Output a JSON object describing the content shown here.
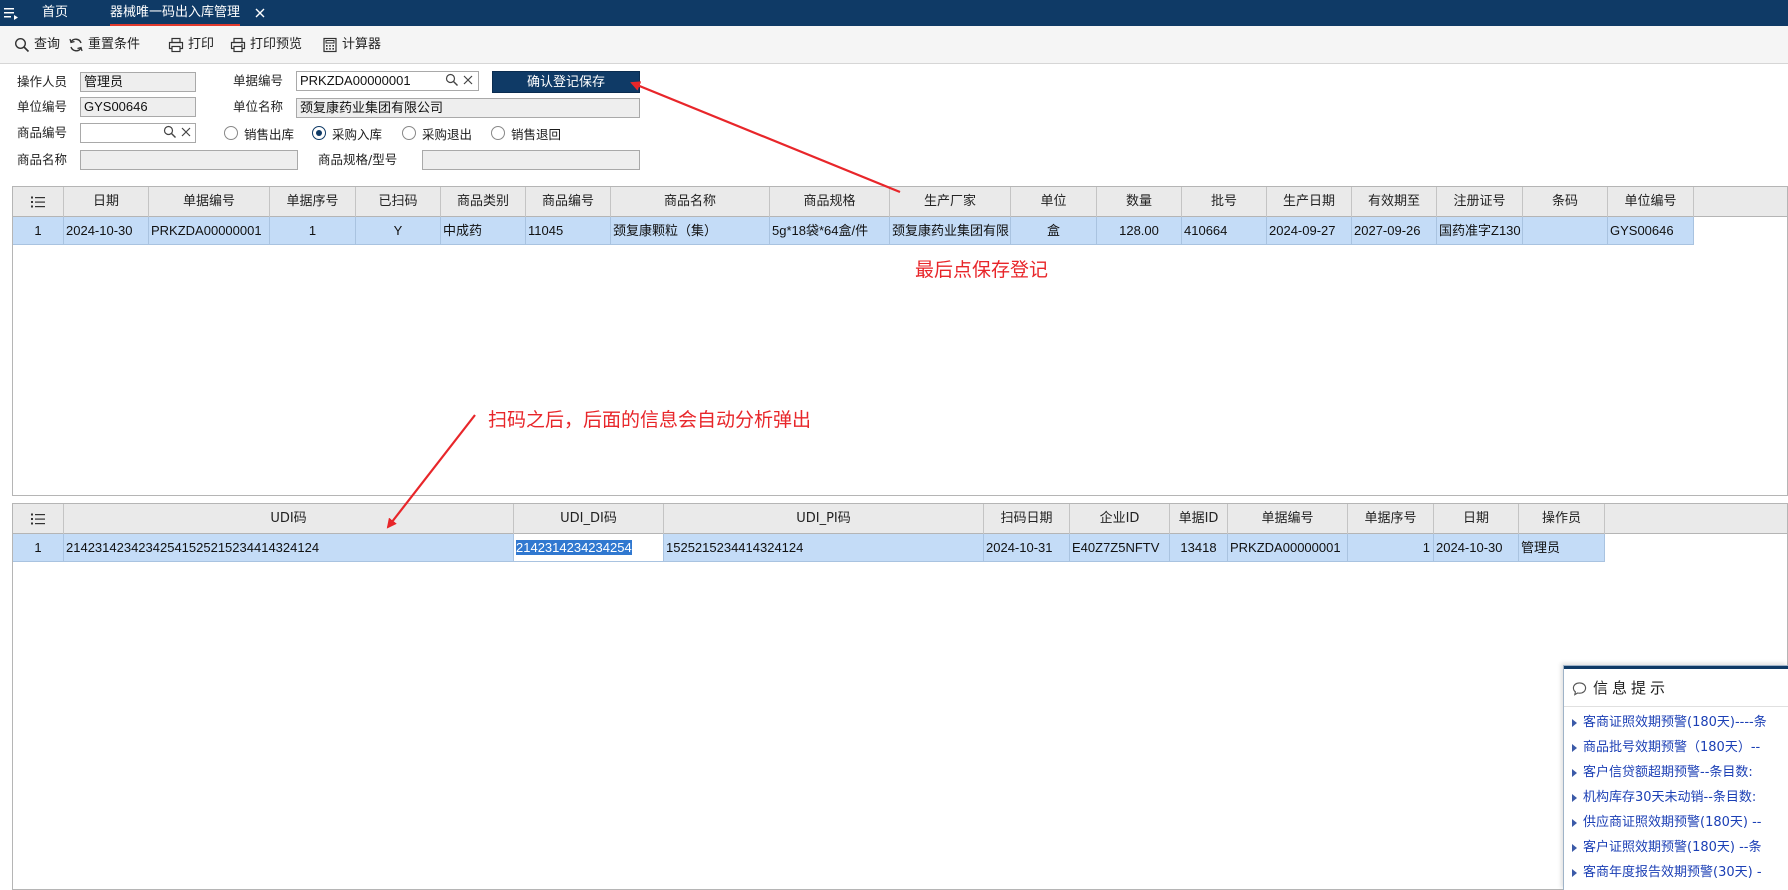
{
  "tabs": {
    "home": "首页",
    "active": "器械唯一码出入库管理"
  },
  "toolbar": {
    "query": "查询",
    "reset": "重置条件",
    "print": "打印",
    "print_preview": "打印预览",
    "calculator": "计算器"
  },
  "form": {
    "operator_label": "操作人员",
    "operator_value": "管理员",
    "doc_no_label": "单据编号",
    "doc_no_value": "PRKZDA00000001",
    "confirm_button": "确认登记保存",
    "unit_no_label": "单位编号",
    "unit_no_value": "GYS00646",
    "unit_name_label": "单位名称",
    "unit_name_value": "颈复康药业集团有限公司",
    "product_no_label": "商品编号",
    "product_no_value": "",
    "radios": [
      {
        "label": "销售出库",
        "checked": false
      },
      {
        "label": "采购入库",
        "checked": true
      },
      {
        "label": "采购退出",
        "checked": false
      },
      {
        "label": "销售退回",
        "checked": false
      }
    ],
    "product_name_label": "商品名称",
    "product_name_value": "",
    "spec_label": "商品规格/型号",
    "spec_value": ""
  },
  "grid1": {
    "columns": [
      "日期",
      "单据编号",
      "单据序号",
      "已扫码",
      "商品类别",
      "商品编号",
      "商品名称",
      "商品规格",
      "生产厂家",
      "单位",
      "数量",
      "批号",
      "生产日期",
      "有效期至",
      "注册证号",
      "条码",
      "单位编号"
    ],
    "row": [
      "1",
      "2024-10-30",
      "PRKZDA00000001",
      "1",
      "Y",
      "中成药",
      "11045",
      "颈复康颗粒（集）",
      "5g*18袋*64盒/件",
      "颈复康药业集团有限",
      "盒",
      "128.00",
      "410664",
      "2024-09-27",
      "2027-09-26",
      "国药准字Z130",
      "",
      "GYS00646"
    ]
  },
  "grid2": {
    "columns": [
      "UDI码",
      "UDI_DI码",
      "UDI_PI码",
      "扫码日期",
      "企业ID",
      "单据ID",
      "单据编号",
      "单据序号",
      "日期",
      "操作员"
    ],
    "row": [
      "1",
      "21423142342342541525215234414324124",
      "2142314234234254",
      "1525215234414324124",
      "2024-10-31",
      "E40Z7Z5NFTV",
      "13418",
      "PRKZDA00000001",
      "1",
      "2024-10-30",
      "管理员"
    ]
  },
  "annotations": {
    "save_note": "最后点保存登记",
    "scan_note": "扫码之后，后面的信息会自动分析弹出",
    "color": "#e8262a"
  },
  "info_panel": {
    "title": "信息提示",
    "items": [
      "客商证照效期预警(180天)----条",
      "商品批号效期预警（180天）--",
      "客户信贷额超期预警--条目数:",
      "机构库存30天未动销--条目数:",
      "供应商证照效期预警(180天) --",
      "客户证照效期预警(180天) --条",
      "客商年度报告效期预警(30天) -"
    ]
  },
  "colors": {
    "header_bg": "#0f3a66",
    "selected_row": "#c4dcf7",
    "accent_red": "#e03a2e"
  },
  "icons": [
    "menu-icon",
    "close-icon",
    "search-icon",
    "refresh-icon",
    "printer-icon",
    "print-preview-icon",
    "calculator-icon",
    "clear-icon",
    "list-icon",
    "chat-icon"
  ]
}
